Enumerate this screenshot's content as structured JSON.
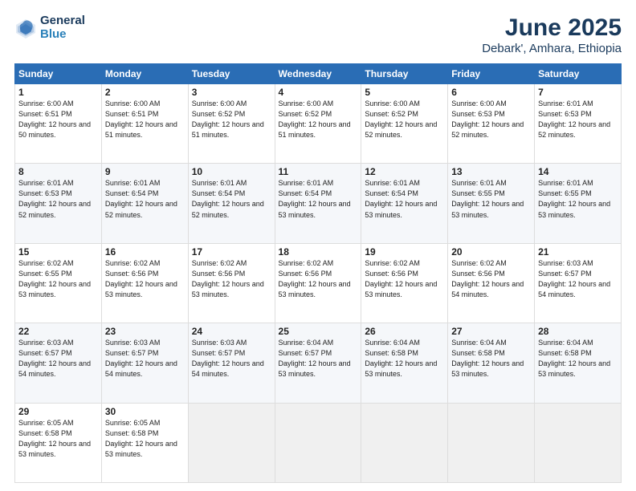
{
  "header": {
    "logo_line1": "General",
    "logo_line2": "Blue",
    "title": "June 2025",
    "subtitle": "Debark', Amhara, Ethiopia"
  },
  "weekdays": [
    "Sunday",
    "Monday",
    "Tuesday",
    "Wednesday",
    "Thursday",
    "Friday",
    "Saturday"
  ],
  "weeks": [
    [
      {
        "day": "1",
        "sunrise": "6:00 AM",
        "sunset": "6:51 PM",
        "daylight": "12 hours and 50 minutes."
      },
      {
        "day": "2",
        "sunrise": "6:00 AM",
        "sunset": "6:51 PM",
        "daylight": "12 hours and 51 minutes."
      },
      {
        "day": "3",
        "sunrise": "6:00 AM",
        "sunset": "6:52 PM",
        "daylight": "12 hours and 51 minutes."
      },
      {
        "day": "4",
        "sunrise": "6:00 AM",
        "sunset": "6:52 PM",
        "daylight": "12 hours and 51 minutes."
      },
      {
        "day": "5",
        "sunrise": "6:00 AM",
        "sunset": "6:52 PM",
        "daylight": "12 hours and 52 minutes."
      },
      {
        "day": "6",
        "sunrise": "6:00 AM",
        "sunset": "6:53 PM",
        "daylight": "12 hours and 52 minutes."
      },
      {
        "day": "7",
        "sunrise": "6:01 AM",
        "sunset": "6:53 PM",
        "daylight": "12 hours and 52 minutes."
      }
    ],
    [
      {
        "day": "8",
        "sunrise": "6:01 AM",
        "sunset": "6:53 PM",
        "daylight": "12 hours and 52 minutes."
      },
      {
        "day": "9",
        "sunrise": "6:01 AM",
        "sunset": "6:54 PM",
        "daylight": "12 hours and 52 minutes."
      },
      {
        "day": "10",
        "sunrise": "6:01 AM",
        "sunset": "6:54 PM",
        "daylight": "12 hours and 52 minutes."
      },
      {
        "day": "11",
        "sunrise": "6:01 AM",
        "sunset": "6:54 PM",
        "daylight": "12 hours and 53 minutes."
      },
      {
        "day": "12",
        "sunrise": "6:01 AM",
        "sunset": "6:54 PM",
        "daylight": "12 hours and 53 minutes."
      },
      {
        "day": "13",
        "sunrise": "6:01 AM",
        "sunset": "6:55 PM",
        "daylight": "12 hours and 53 minutes."
      },
      {
        "day": "14",
        "sunrise": "6:01 AM",
        "sunset": "6:55 PM",
        "daylight": "12 hours and 53 minutes."
      }
    ],
    [
      {
        "day": "15",
        "sunrise": "6:02 AM",
        "sunset": "6:55 PM",
        "daylight": "12 hours and 53 minutes."
      },
      {
        "day": "16",
        "sunrise": "6:02 AM",
        "sunset": "6:56 PM",
        "daylight": "12 hours and 53 minutes."
      },
      {
        "day": "17",
        "sunrise": "6:02 AM",
        "sunset": "6:56 PM",
        "daylight": "12 hours and 53 minutes."
      },
      {
        "day": "18",
        "sunrise": "6:02 AM",
        "sunset": "6:56 PM",
        "daylight": "12 hours and 53 minutes."
      },
      {
        "day": "19",
        "sunrise": "6:02 AM",
        "sunset": "6:56 PM",
        "daylight": "12 hours and 53 minutes."
      },
      {
        "day": "20",
        "sunrise": "6:02 AM",
        "sunset": "6:56 PM",
        "daylight": "12 hours and 54 minutes."
      },
      {
        "day": "21",
        "sunrise": "6:03 AM",
        "sunset": "6:57 PM",
        "daylight": "12 hours and 54 minutes."
      }
    ],
    [
      {
        "day": "22",
        "sunrise": "6:03 AM",
        "sunset": "6:57 PM",
        "daylight": "12 hours and 54 minutes."
      },
      {
        "day": "23",
        "sunrise": "6:03 AM",
        "sunset": "6:57 PM",
        "daylight": "12 hours and 54 minutes."
      },
      {
        "day": "24",
        "sunrise": "6:03 AM",
        "sunset": "6:57 PM",
        "daylight": "12 hours and 54 minutes."
      },
      {
        "day": "25",
        "sunrise": "6:04 AM",
        "sunset": "6:57 PM",
        "daylight": "12 hours and 53 minutes."
      },
      {
        "day": "26",
        "sunrise": "6:04 AM",
        "sunset": "6:58 PM",
        "daylight": "12 hours and 53 minutes."
      },
      {
        "day": "27",
        "sunrise": "6:04 AM",
        "sunset": "6:58 PM",
        "daylight": "12 hours and 53 minutes."
      },
      {
        "day": "28",
        "sunrise": "6:04 AM",
        "sunset": "6:58 PM",
        "daylight": "12 hours and 53 minutes."
      }
    ],
    [
      {
        "day": "29",
        "sunrise": "6:05 AM",
        "sunset": "6:58 PM",
        "daylight": "12 hours and 53 minutes."
      },
      {
        "day": "30",
        "sunrise": "6:05 AM",
        "sunset": "6:58 PM",
        "daylight": "12 hours and 53 minutes."
      },
      null,
      null,
      null,
      null,
      null
    ]
  ]
}
